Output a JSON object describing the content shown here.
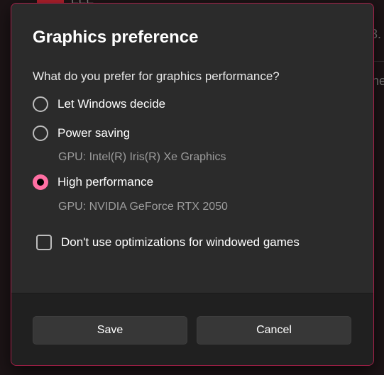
{
  "dialog": {
    "title": "Graphics preference",
    "question": "What do you prefer for graphics performance?",
    "options": [
      {
        "label": "Let Windows decide",
        "selected": false,
        "gpu": ""
      },
      {
        "label": "Power saving",
        "selected": false,
        "gpu": "GPU: Intel(R) Iris(R) Xe Graphics"
      },
      {
        "label": "High performance",
        "selected": true,
        "gpu": "GPU: NVIDIA GeForce RTX 2050"
      }
    ],
    "checkbox": {
      "label": "Don't use optimizations for windowed games",
      "checked": false
    },
    "buttons": {
      "save": "Save",
      "cancel": "Cancel"
    },
    "accent_color": "#ff6fa3",
    "border_color": "#a52049"
  },
  "background": {
    "top_text": "ЕЕЕ",
    "right_text_1": "3.",
    "right_text_2": "ne"
  }
}
